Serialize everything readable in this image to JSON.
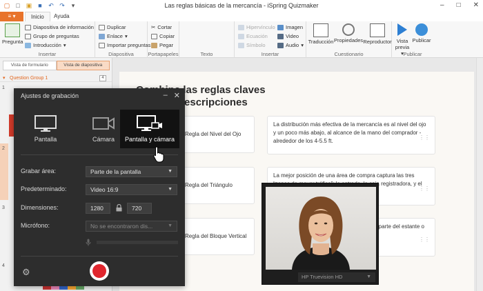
{
  "window": {
    "title": "Las reglas básicas de la mercancía - iSpring Quizmaker",
    "file_tab": "≡ ▾",
    "tabs": [
      "Inicio",
      "Ayuda"
    ]
  },
  "ribbon": {
    "insertar": {
      "label": "Insertar",
      "pregunta": "Pregunta",
      "items": [
        "Diapositiva de información",
        "Grupo de preguntas",
        "Introducción"
      ]
    },
    "diapositiva": {
      "label": "Diapositiva",
      "items": [
        "Duplicar",
        "Enlace",
        "Importar preguntas"
      ]
    },
    "portapapeles": {
      "label": "Portapapeles",
      "items": [
        "Cortar",
        "Copiar",
        "Pegar"
      ]
    },
    "texto": {
      "label": "Texto"
    },
    "insertar2": {
      "label": "Insertar",
      "items_disabled": [
        "Hipervínculo",
        "Ecuación",
        "Símbolo"
      ],
      "items": [
        "Imagen",
        "Video",
        "Audio"
      ]
    },
    "cuestionario": {
      "label": "Cuestionario",
      "items": [
        "Traducción",
        "Propiedades",
        "Reproductor"
      ]
    },
    "publicar": {
      "label": "Publicar",
      "vista_previa_1": "Vista",
      "vista_previa_2": "previa",
      "publicar": "Publicar"
    }
  },
  "left_panel": {
    "view_tabs": [
      "Vista de formulario",
      "Vista de diapositiva"
    ],
    "group_name": "Question Group 1",
    "group_count": "4",
    "slide_numbers": [
      "1",
      "2",
      "3",
      "4"
    ]
  },
  "slide": {
    "title_line1": "Combina las reglas claves",
    "title_line2": "con sus descripciones",
    "left_cards": [
      "Regla del Nivel del Ojo",
      "Regla del Triángulo",
      "Regla del Bloque Vertical"
    ],
    "right_cards": [
      "La distribución más efectiva de la mercancía es al nivel del ojo y un poco más abajo, al alcance de la mano del comprador - alrededor de los 4-5.5 ft.",
      "La mejor posición de una área de compra captura las tres “zonas de mayor tráfico”: la entrada, la caja registradora, y el área de",
      "Tiene la disposición de los productos en la parte del estante o un poco más de modo que un punto de"
    ]
  },
  "recording_dialog": {
    "title": "Ajustes de grabación",
    "minimize": "–",
    "close": "✕",
    "modes": [
      "Pantalla",
      "Cámara",
      "Pantalla y cámara"
    ],
    "active_mode": "Pantalla y cámara",
    "grabar_area_label": "Grabar área:",
    "grabar_area_value": "Parte de la pantalla",
    "predeterminado_label": "Predeterminado:",
    "predeterminado_value": "Video 16:9",
    "dimensiones_label": "Dimensiones:",
    "width": "1280",
    "height": "720",
    "microfono_label": "Micrófono:",
    "microfono_value": "No se encontraron dis...",
    "caret": "▼"
  },
  "webcam": {
    "device": "HP Truevision HD",
    "caret": "▼"
  },
  "colors": {
    "accent": "#e8732b",
    "dialog_bg": "#2d2d2d",
    "record_red": "#e0262e"
  }
}
